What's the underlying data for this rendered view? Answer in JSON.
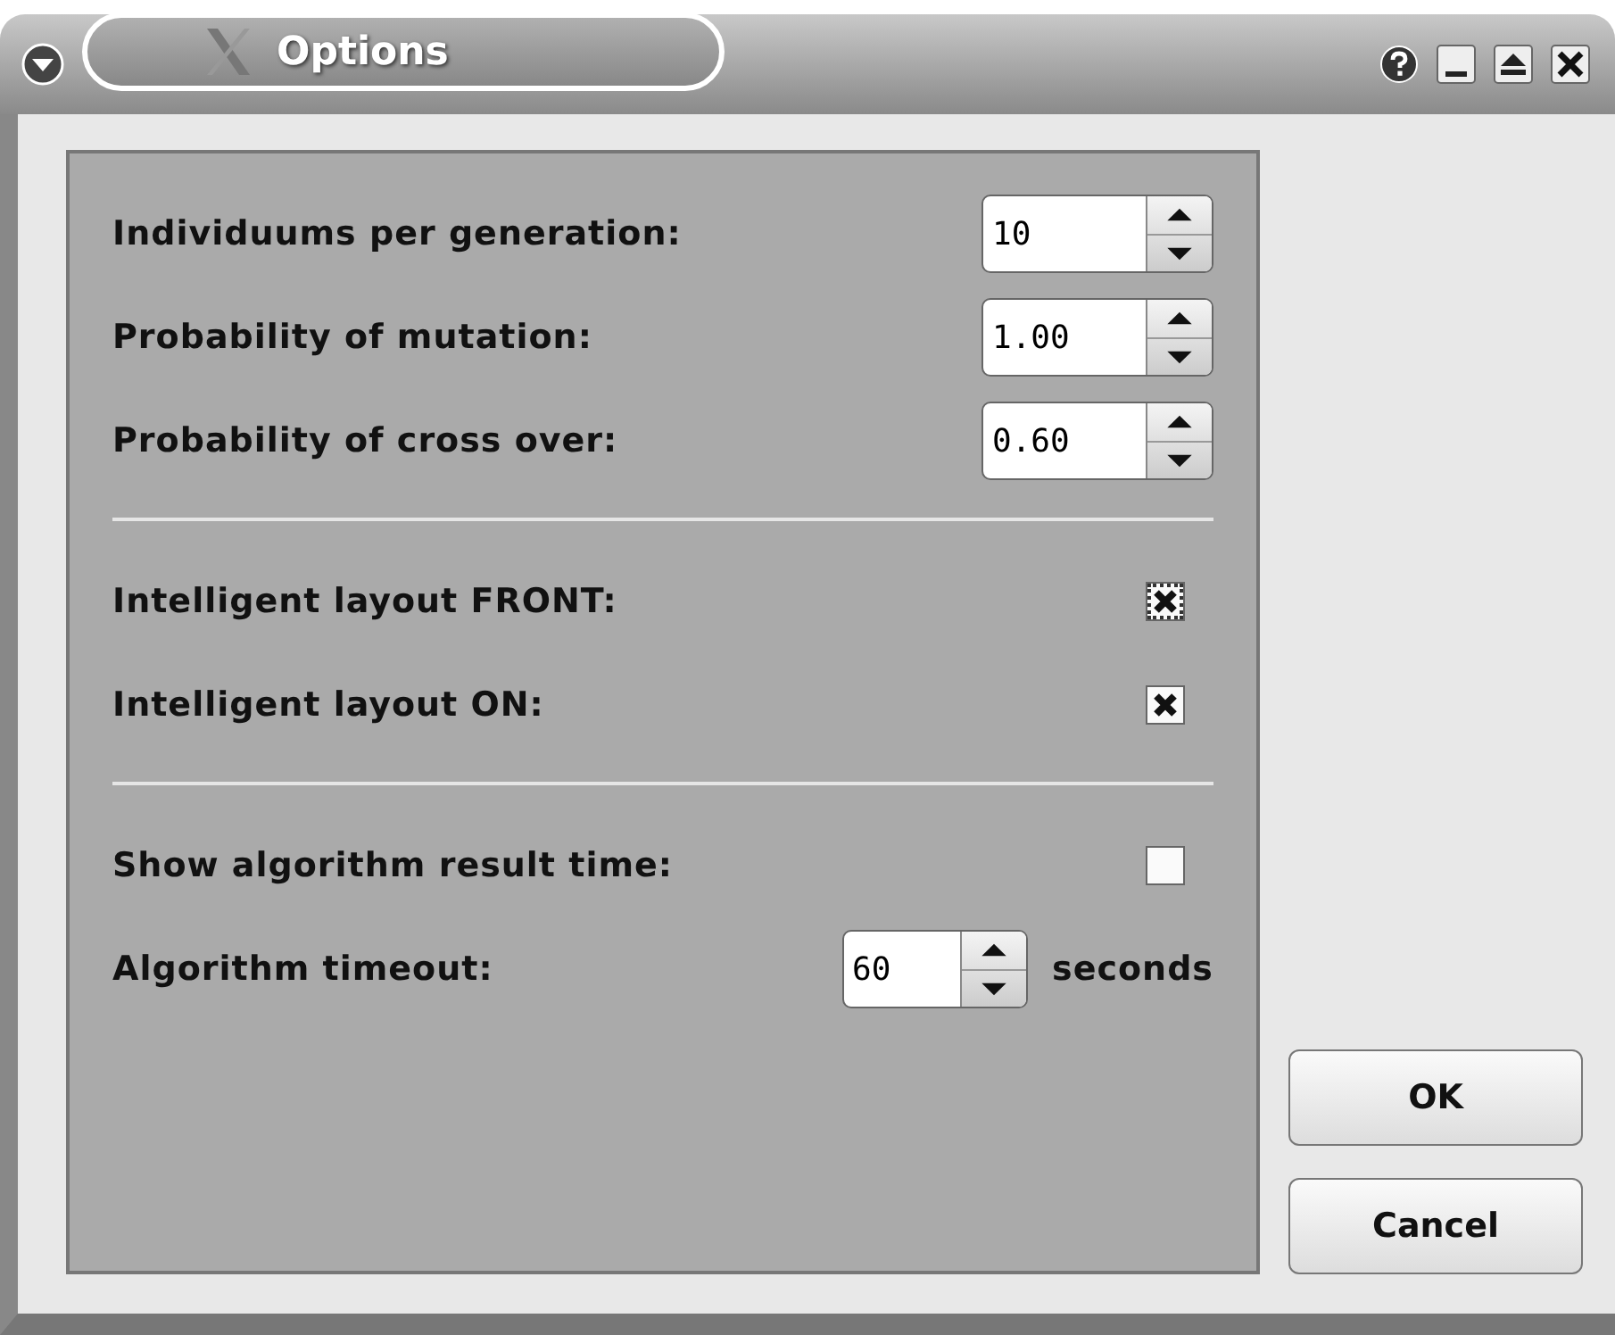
{
  "window": {
    "title": "Options"
  },
  "sections": [
    {
      "rows": [
        {
          "kind": "spin",
          "label": "Individuums per generation:",
          "value": "10"
        },
        {
          "kind": "spin",
          "label": "Probability of mutation:",
          "value": "1.00"
        },
        {
          "kind": "spin",
          "label": "Probability of cross over:",
          "value": "0.60"
        }
      ]
    },
    {
      "rows": [
        {
          "kind": "check",
          "label": "Intelligent layout FRONT:",
          "checked": true,
          "focused": true
        },
        {
          "kind": "check",
          "label": "Intelligent layout ON:",
          "checked": true,
          "focused": false
        }
      ]
    },
    {
      "rows": [
        {
          "kind": "check",
          "label": "Show algorithm result time:",
          "checked": false,
          "focused": false
        },
        {
          "kind": "spin-unit",
          "label": "Algorithm timeout:",
          "value": "60",
          "unit": "seconds"
        }
      ]
    }
  ],
  "buttons": [
    "OK",
    "Cancel"
  ]
}
